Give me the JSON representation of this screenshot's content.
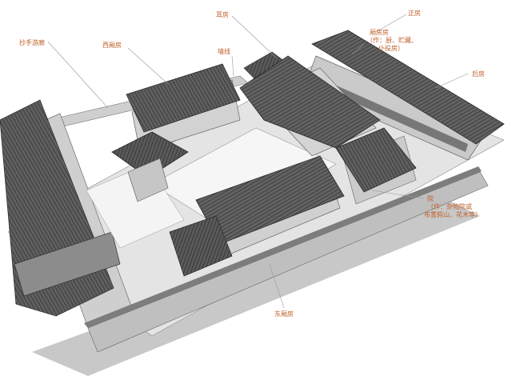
{
  "labels": {
    "er_fang": "耳房",
    "zheng_fang": "正房",
    "xiang_fang_side": "厢房房",
    "xiang_fang_side_note_1": "（作：厨、贮藏、",
    "xiang_fang_side_note_2": "仆役房）",
    "chaoshou_youlang": "抄手游廊",
    "xi_xiangfang": "西厢房",
    "qiang_xian": "墙线",
    "hou_fang": "后房",
    "yard": "院",
    "yard_note_1": "（作：杂物院或",
    "yard_note_2": "布置假山、花木等）",
    "dong_xiangfang": "东厢房"
  },
  "colors": {
    "label_text": "#c0602a",
    "leader_line": "#9a9a9a",
    "roof_dark": "#5c5c5c",
    "roof_tile": "#474747",
    "wall_light": "#d9d9d9",
    "wall_mid": "#bdbdbd",
    "ground": "#ececec",
    "courtyard": "#f7f7f7"
  }
}
